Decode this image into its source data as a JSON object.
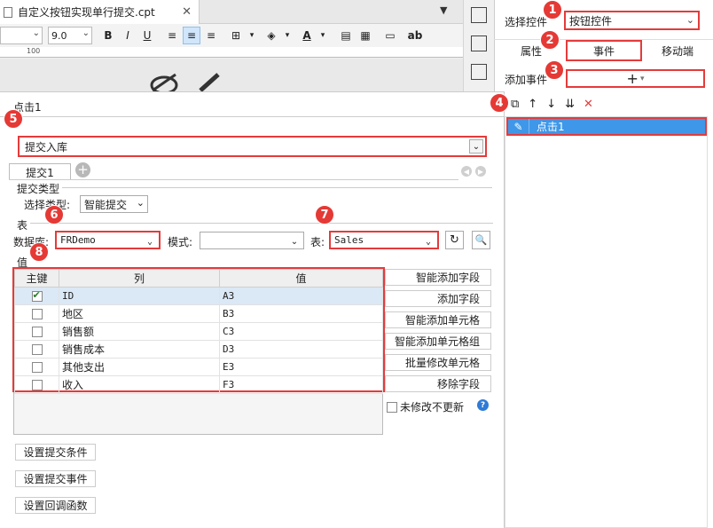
{
  "editor": {
    "file_tab": "自定义按钮实现单行提交.cpt",
    "close_icon": "✕",
    "font_size": "9.0",
    "bold": "B",
    "italic": "I",
    "underline": "U",
    "text_color": "A",
    "ab": "ab",
    "ruler_mark": "100"
  },
  "right_panel": {
    "select_control_label": "选择控件",
    "select_control_value": "按钮控件",
    "tabs": [
      "属性",
      "事件",
      "移动端"
    ],
    "add_event_label": "添加事件",
    "add_event_button": "+",
    "events": [
      "点击1"
    ]
  },
  "dialog": {
    "title": "点击1",
    "submit_type_value": "提交入库",
    "sub_tab": "提交1",
    "submit_type_section": "提交类型",
    "select_type_label": "选择类型:",
    "select_type_value": "智能提交",
    "table_section": "表",
    "database_label": "数据库:",
    "database_value": "FRDemo",
    "mode_label": "模式:",
    "mode_value": "",
    "table_label": "表:",
    "table_value": "Sales",
    "value_section": "值",
    "grid": {
      "headers": [
        "主键",
        "列",
        "值"
      ],
      "rows": [
        {
          "pk": true,
          "col": "ID",
          "val": "A3"
        },
        {
          "pk": false,
          "col": "地区",
          "val": "B3"
        },
        {
          "pk": false,
          "col": "销售额",
          "val": "C3"
        },
        {
          "pk": false,
          "col": "销售成本",
          "val": "D3"
        },
        {
          "pk": false,
          "col": "其他支出",
          "val": "E3"
        },
        {
          "pk": false,
          "col": "收入",
          "val": "F3"
        }
      ]
    },
    "side_buttons": [
      "智能添加字段",
      "添加字段",
      "智能添加单元格",
      "智能添加单元格组",
      "批量修改单元格",
      "移除字段"
    ],
    "no_change_label": "未修改不更新",
    "help": "?",
    "bottom_buttons": [
      "设置提交条件",
      "设置提交事件",
      "设置回调函数"
    ]
  },
  "badges": [
    "1",
    "2",
    "3",
    "4",
    "5",
    "6",
    "7",
    "8"
  ],
  "colors": {
    "highlight": "#e43b3b",
    "selection": "#3e97e8",
    "badge": "#e53935"
  }
}
